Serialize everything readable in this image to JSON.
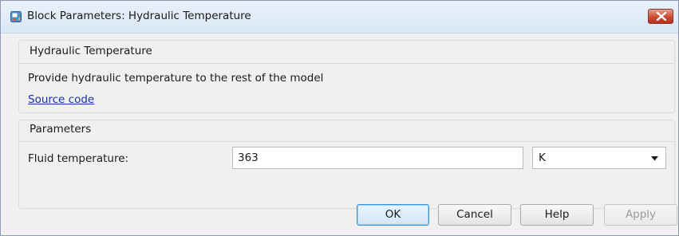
{
  "window": {
    "title": "Block Parameters: Hydraulic Temperature",
    "app_icon": "simulink-block-icon",
    "close_icon": "close-icon",
    "close_color": "#c9452d"
  },
  "description": {
    "heading": "Hydraulic Temperature",
    "text": "Provide hydraulic temperature to the rest of the model",
    "source_link": "Source code"
  },
  "parameters": {
    "heading": "Parameters",
    "fluid_temperature": {
      "label": "Fluid temperature:",
      "value": "363",
      "unit": "K",
      "unit_icon": "dropdown-arrow-icon"
    }
  },
  "buttons": {
    "ok": "OK",
    "cancel": "Cancel",
    "help": "Help",
    "apply": "Apply"
  },
  "colors": {
    "link": "#1530aa",
    "default_button_border": "#3c8fd6"
  }
}
